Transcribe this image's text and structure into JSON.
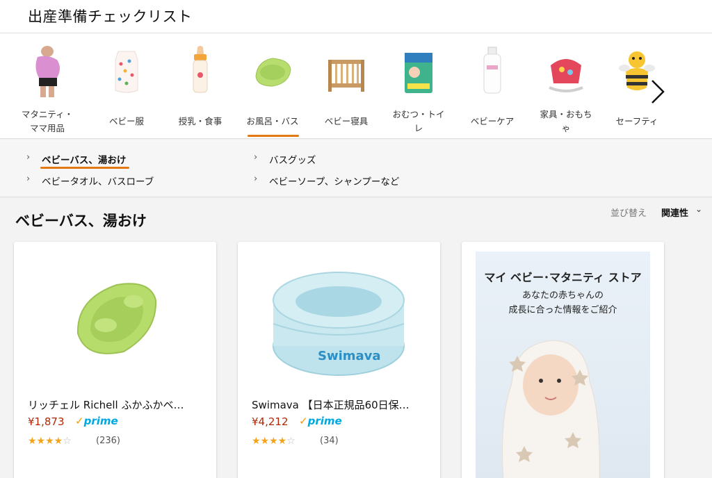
{
  "header": {
    "title": "出産準備チェックリスト"
  },
  "categories": [
    {
      "label_line1": "マタニティ・",
      "label_line2": "ママ用品",
      "icon": "maternity-icon"
    },
    {
      "label": "ベビー服",
      "icon": "baby-clothes-icon"
    },
    {
      "label": "授乳・食事",
      "icon": "baby-bottle-icon"
    },
    {
      "label": "お風呂・バス",
      "icon": "baby-bath-icon",
      "active": true
    },
    {
      "label": "ベビー寝具",
      "icon": "crib-icon"
    },
    {
      "label_line1": "おむつ・トイ",
      "label_line2": "レ",
      "icon": "diaper-icon"
    },
    {
      "label": "ベビーケア",
      "icon": "lotion-icon"
    },
    {
      "label_line1": "家具・おもち",
      "label_line2": "ゃ",
      "icon": "rocker-icon"
    },
    {
      "label": "セーフティ",
      "icon": "safety-cushion-icon"
    }
  ],
  "subnav": {
    "items": [
      "ベビーバス、湯おけ",
      "バスグッズ",
      "ベビータオル、バスローブ",
      "ベビーソープ、シャンプーなど"
    ],
    "active_index": 0
  },
  "section": {
    "title": "ベビーバス、湯おけ",
    "sort_label": "並び替え",
    "sort_value": "関連性"
  },
  "products": [
    {
      "title": "リッチェル Richell ふかふかベ…",
      "price": "¥1,873",
      "prime": "prime",
      "rating": 4,
      "reviews": "(236)"
    },
    {
      "title": "Swimava 【日本正規品60日保…",
      "price": "¥4,212",
      "prime": "prime",
      "rating": 4,
      "reviews": "(34)"
    }
  ],
  "product_image_text": {
    "brand": "Swimava"
  },
  "ad": {
    "title": "マイ ベビー･マタニティ ストア",
    "line1": "あなたの赤ちゃんの",
    "line2": "成長に合った情報をご紹介"
  },
  "colors": {
    "accent": "#e47911",
    "price": "#b12704",
    "prime_blue": "#00a8e1",
    "star": "#f4a41a"
  }
}
